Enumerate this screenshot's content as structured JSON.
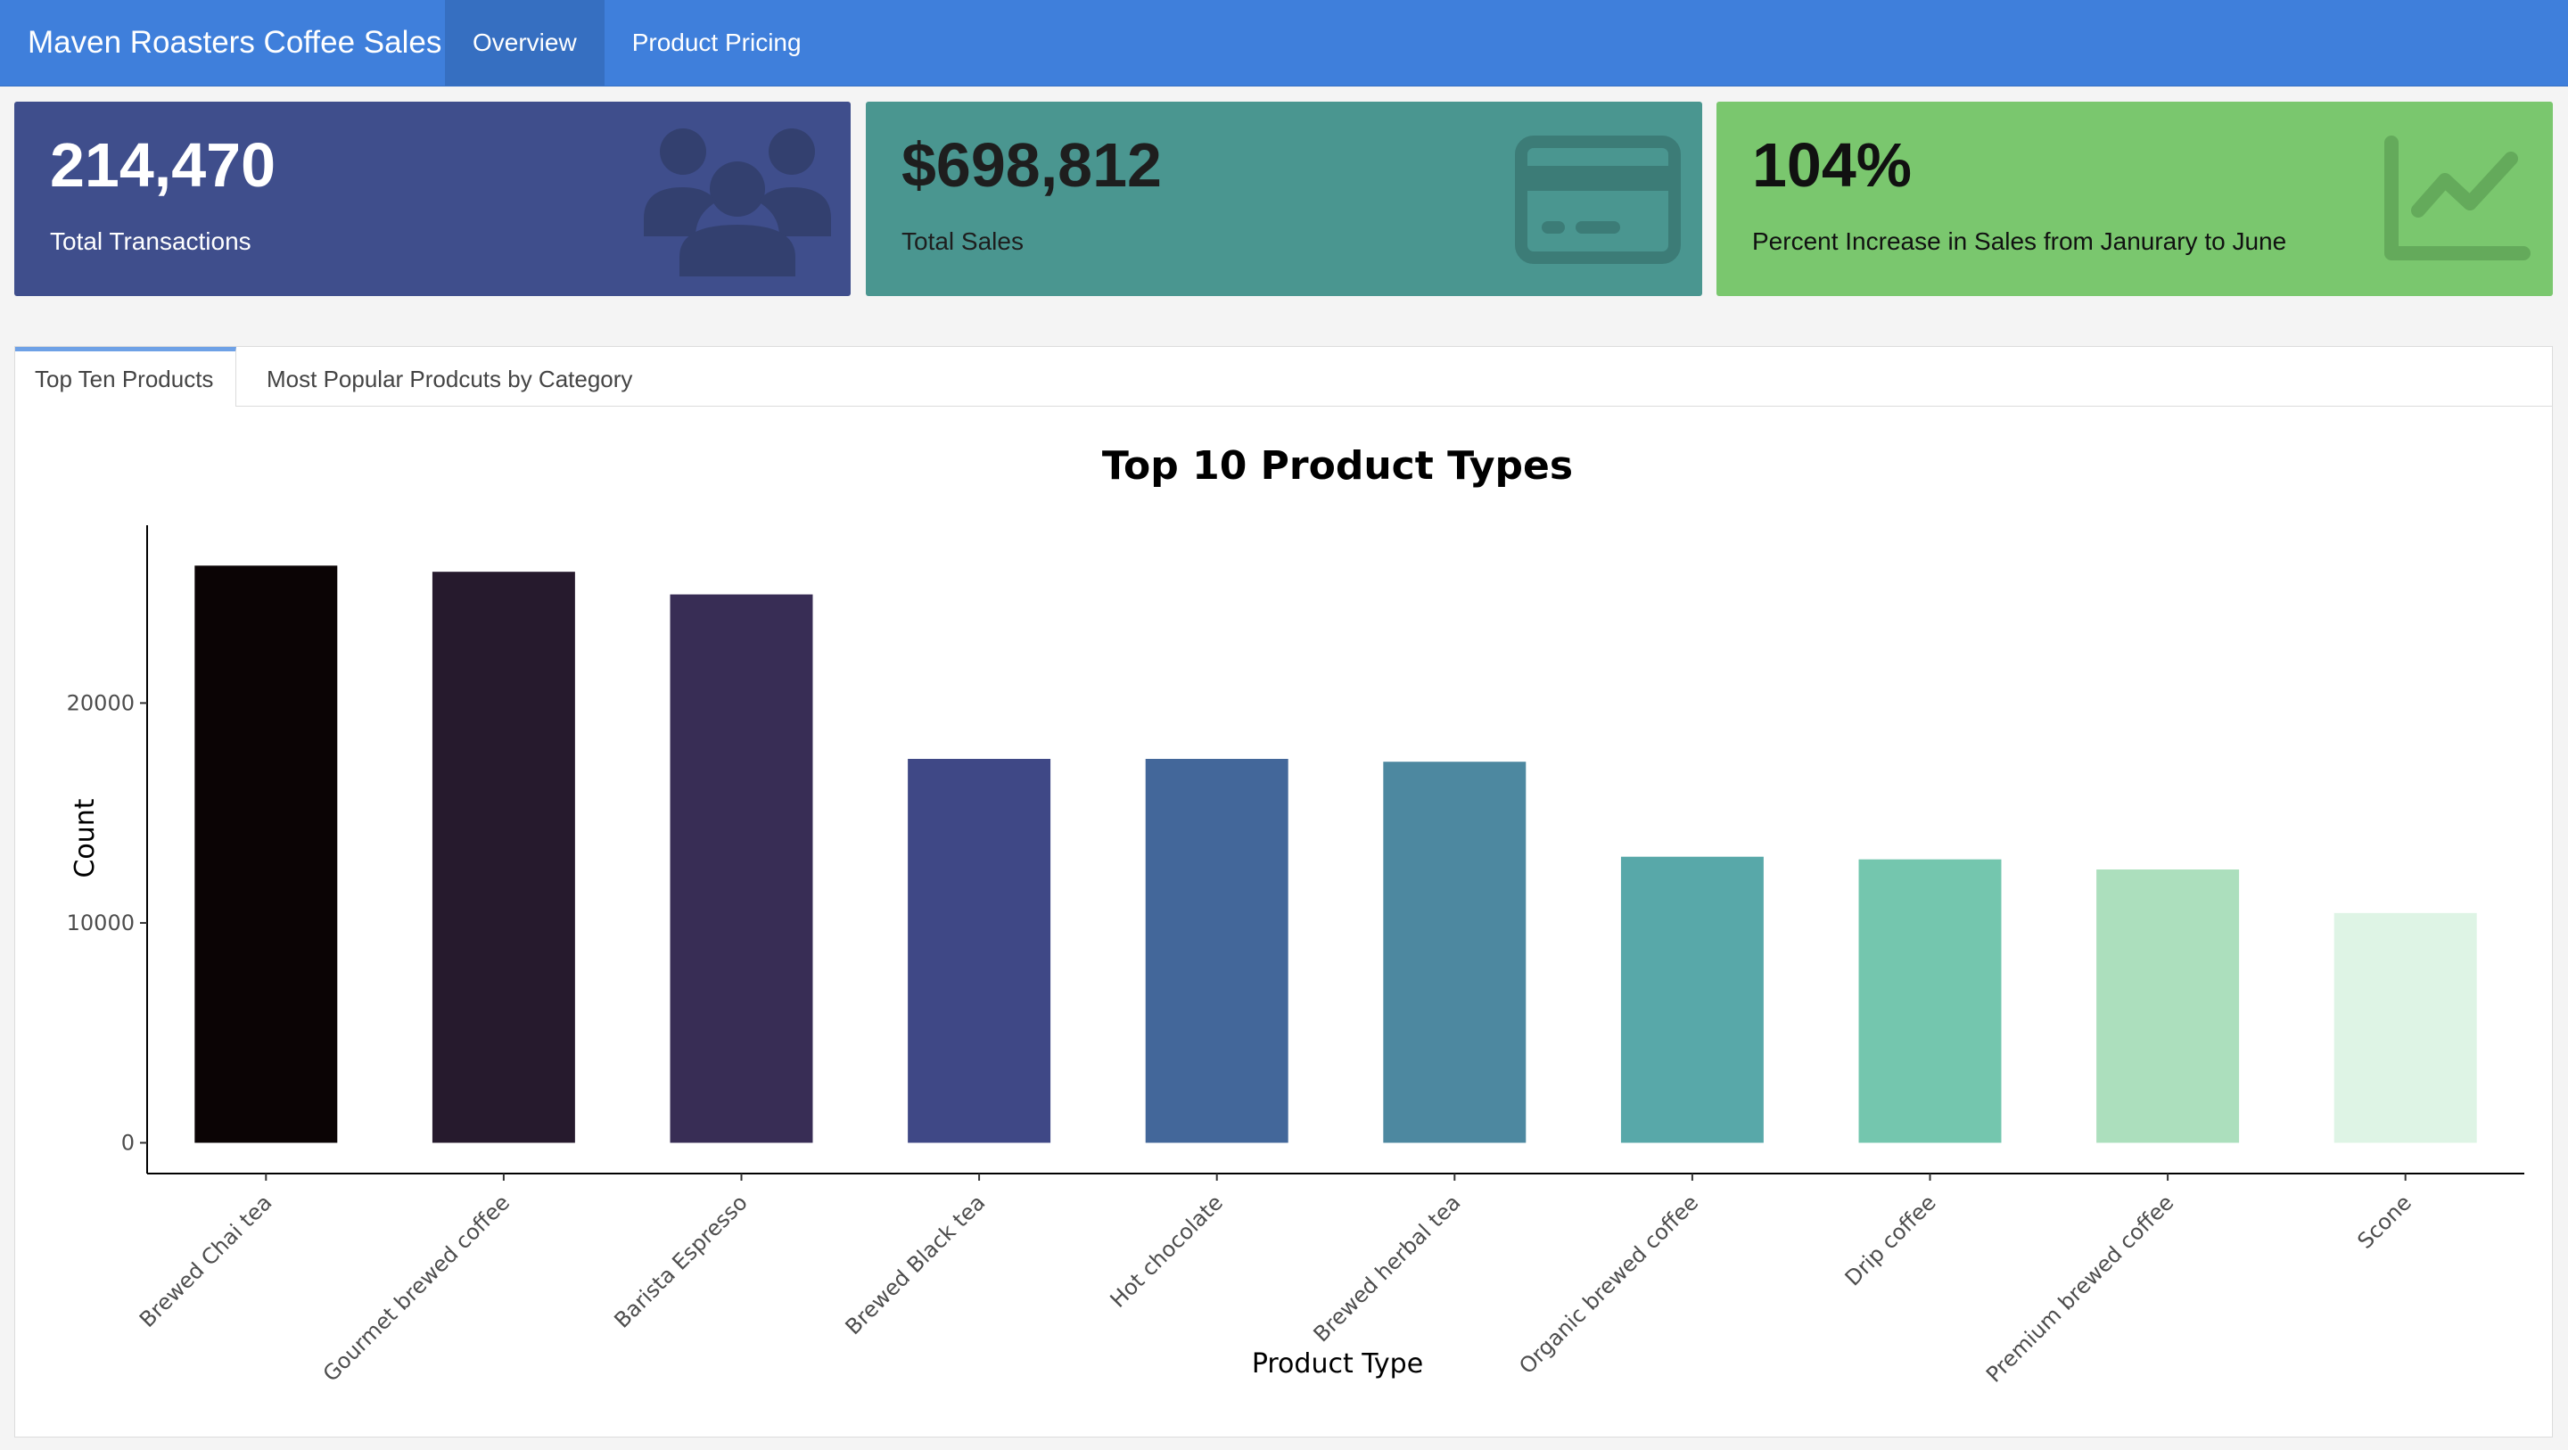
{
  "navbar": {
    "title": "Maven Roasters Coffee Sales",
    "tabs": [
      "Overview",
      "Product Pricing"
    ]
  },
  "value_boxes": [
    {
      "value": "214,470",
      "caption": "Total Transactions",
      "icon": "users-icon",
      "color": "#3f4e8c"
    },
    {
      "value": "$698,812",
      "caption": "Total Sales",
      "icon": "credit-card-icon",
      "color": "#4a9690"
    },
    {
      "value": "104%",
      "caption": "Percent Increase in Sales from Janurary to June",
      "icon": "line-chart-icon",
      "color": "#7ac76e"
    }
  ],
  "tabs": [
    "Top Ten Products",
    "Most Popular Prodcuts by Category"
  ],
  "chart_data": {
    "type": "bar",
    "title": "Top 10 Product Types",
    "xlabel": "Product Type",
    "ylabel": "Count",
    "categories": [
      "Brewed Chai tea",
      "Gourmet brewed coffee",
      "Barista Espresso",
      "Brewed Black tea",
      "Hot chocolate",
      "Brewed herbal tea",
      "Organic brewed coffee",
      "Drip coffee",
      "Premium brewed coffee",
      "Scone"
    ],
    "values": [
      26250,
      25970,
      24940,
      17460,
      17460,
      17330,
      13010,
      12890,
      12430,
      10450
    ],
    "colors": [
      "#0b0405",
      "#261a2d",
      "#382d55",
      "#3f4886",
      "#43679a",
      "#4d88a0",
      "#58a8a9",
      "#74c6ae",
      "#acdfbd",
      "#def4e5"
    ],
    "yticks": [
      0,
      10000,
      20000
    ],
    "ylim": [
      -1400,
      27600
    ],
    "grid": false
  }
}
